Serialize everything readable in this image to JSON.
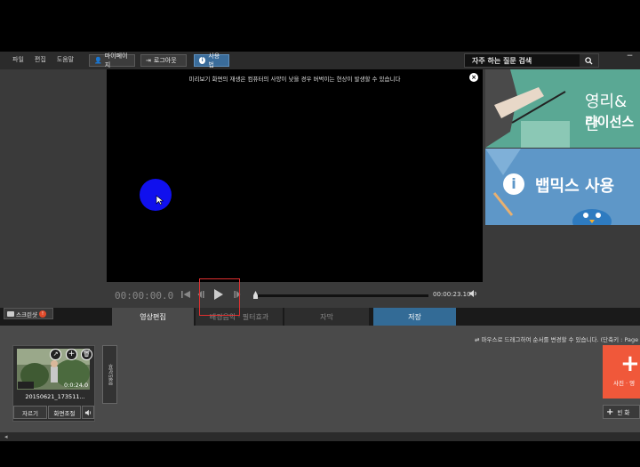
{
  "menu": [
    "파일",
    "편집",
    "도움말"
  ],
  "top_buttons": {
    "mypage": "마이페이지",
    "logout": "로그아웃",
    "help": "사용법"
  },
  "search": {
    "value": "자주 하는 질문 검색"
  },
  "window": {
    "minimize": "−"
  },
  "preview": {
    "notice": "미리보기 화면의 재생은 컴퓨터의 사양이 낮을 경우 버벅이는 현상이 발생할 수 있습니다",
    "close": "×"
  },
  "banners": {
    "top": {
      "line1": "영리&단",
      "line2": "라이선스"
    },
    "bottom": {
      "text": "뱁믹스 사용"
    }
  },
  "player": {
    "timecode": "00:00:00.0",
    "duration": "00:00:23.10",
    "progress": 0
  },
  "screenshot_button": "스크린샷",
  "tabs": [
    "영상편집",
    "배경음악 · 필터효과",
    "자막",
    "저장"
  ],
  "timeline": {
    "hint": "마우스로 드래그하여 순서를 변경할 수 있습니다. (단축키 : Page Up",
    "clip": {
      "title": "20150621_173511...",
      "duration": "0:0:24.0",
      "cut": "자르기",
      "adjust": "화면조절"
    },
    "transition": "효과없음",
    "add_media": "사진 · 영",
    "add_blank": "빈 화"
  },
  "colors": {
    "help_button": "#3a6c9a",
    "save_tab": "#336b96",
    "add_button": "#f0583a",
    "highlight": "#e03030",
    "cursor": "#1010ee"
  }
}
